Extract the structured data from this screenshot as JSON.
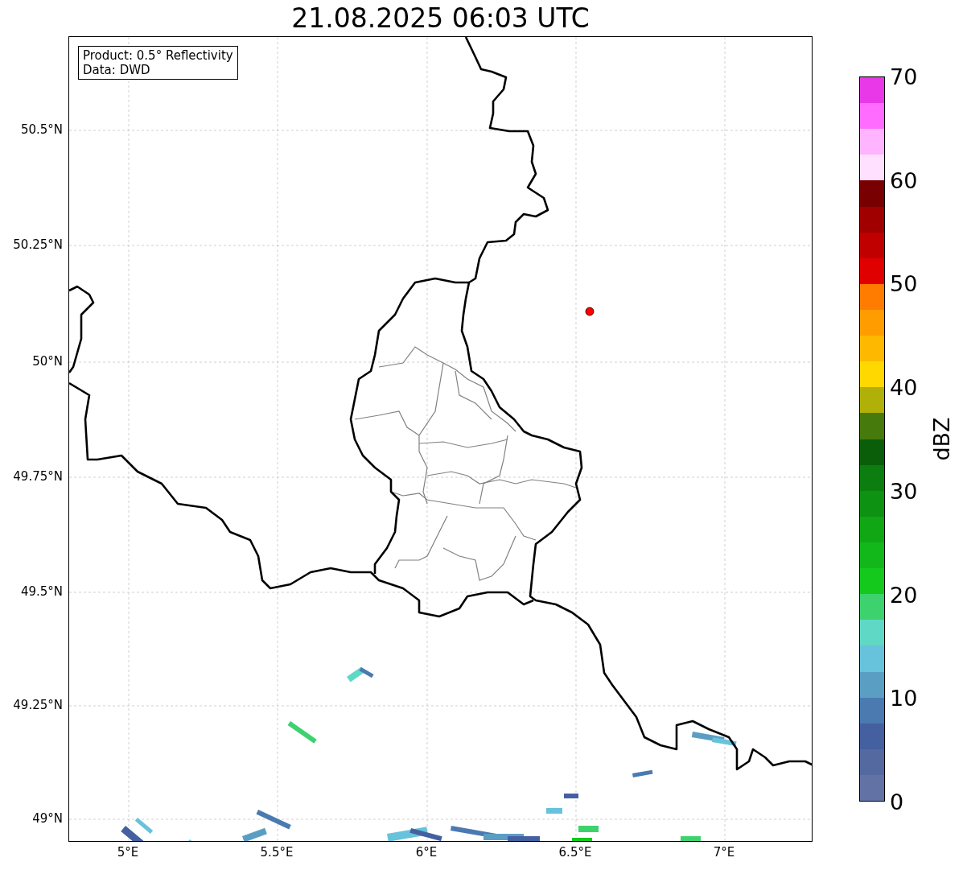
{
  "title": "21.08.2025 06:03 UTC",
  "info_box": {
    "lines": [
      "Product: 0.5° Reflectivity",
      "Data: DWD"
    ]
  },
  "map": {
    "x_ticks": [
      "5°E",
      "5.5°E",
      "6°E",
      "6.5°E",
      "7°E"
    ],
    "y_ticks": [
      "50.5°N",
      "50.25°N",
      "50°N",
      "49.75°N",
      "49.5°N",
      "49.25°N",
      "49°N"
    ]
  },
  "colorbar": {
    "label": "dBZ",
    "ticks": [
      "70",
      "60",
      "50",
      "40",
      "30",
      "20",
      "10",
      "0"
    ],
    "bins": [
      {
        "color": "#e838e8"
      },
      {
        "color": "#ff6cff"
      },
      {
        "color": "#ffb4ff"
      },
      {
        "color": "#ffe0ff"
      },
      {
        "color": "#780000"
      },
      {
        "color": "#a00000"
      },
      {
        "color": "#c00000"
      },
      {
        "color": "#e00000"
      },
      {
        "color": "#ff7c00"
      },
      {
        "color": "#ff9c00"
      },
      {
        "color": "#ffb800"
      },
      {
        "color": "#ffd800"
      },
      {
        "color": "#b0b008"
      },
      {
        "color": "#467a0c"
      },
      {
        "color": "#0a5e0a"
      },
      {
        "color": "#0c7e10"
      },
      {
        "color": "#0e9212"
      },
      {
        "color": "#10a614"
      },
      {
        "color": "#12b81a"
      },
      {
        "color": "#14c81c"
      },
      {
        "color": "#3dd26e"
      },
      {
        "color": "#5fd8c5"
      },
      {
        "color": "#66c3db"
      },
      {
        "color": "#5b9ec4"
      },
      {
        "color": "#4a7ab0"
      },
      {
        "color": "#4460a0"
      },
      {
        "color": "#5469a0"
      },
      {
        "color": "#6372a4"
      }
    ]
  }
}
